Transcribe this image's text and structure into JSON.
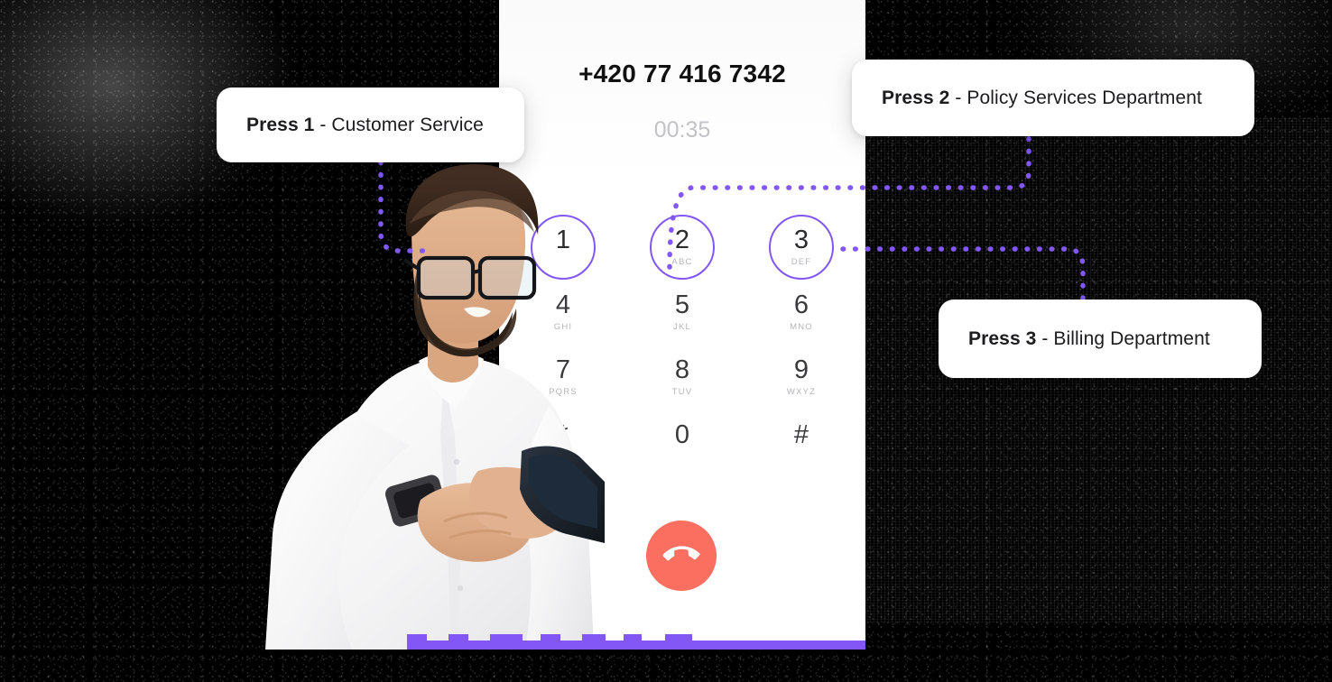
{
  "call": {
    "phone_number": "+420 77 416 7342",
    "timer": "00:35",
    "end_call_icon": "phone-hangup-icon"
  },
  "keypad": {
    "keys": [
      {
        "digit": "1",
        "letters": "",
        "highlighted": true
      },
      {
        "digit": "2",
        "letters": "ABC",
        "highlighted": true
      },
      {
        "digit": "3",
        "letters": "DEF",
        "highlighted": true
      },
      {
        "digit": "4",
        "letters": "GHI",
        "highlighted": false
      },
      {
        "digit": "5",
        "letters": "JKL",
        "highlighted": false
      },
      {
        "digit": "6",
        "letters": "MNO",
        "highlighted": false
      },
      {
        "digit": "7",
        "letters": "PQRS",
        "highlighted": false
      },
      {
        "digit": "8",
        "letters": "TUV",
        "highlighted": false
      },
      {
        "digit": "9",
        "letters": "WXYZ",
        "highlighted": false
      },
      {
        "digit": "*",
        "letters": "",
        "highlighted": false
      },
      {
        "digit": "0",
        "letters": "",
        "highlighted": false
      },
      {
        "digit": "#",
        "letters": "",
        "highlighted": false
      }
    ]
  },
  "callouts": [
    {
      "press": "Press 1",
      "separator": " - ",
      "label": "Customer Service"
    },
    {
      "press": "Press 2",
      "separator": " - ",
      "label": "Policy Services Department"
    },
    {
      "press": "Press 3",
      "separator": " - ",
      "label": "Billing Department"
    }
  ],
  "colors": {
    "accent_purple": "#8257f5",
    "end_call_red": "#fa6f60",
    "panel_white": "#ffffff",
    "digit_gray": "#3a3a3c",
    "letters_gray": "#b6b6ba",
    "timer_gray": "#c3c3c6",
    "background_black": "#000000"
  },
  "person": {
    "description": "man-with-phone-photo"
  }
}
